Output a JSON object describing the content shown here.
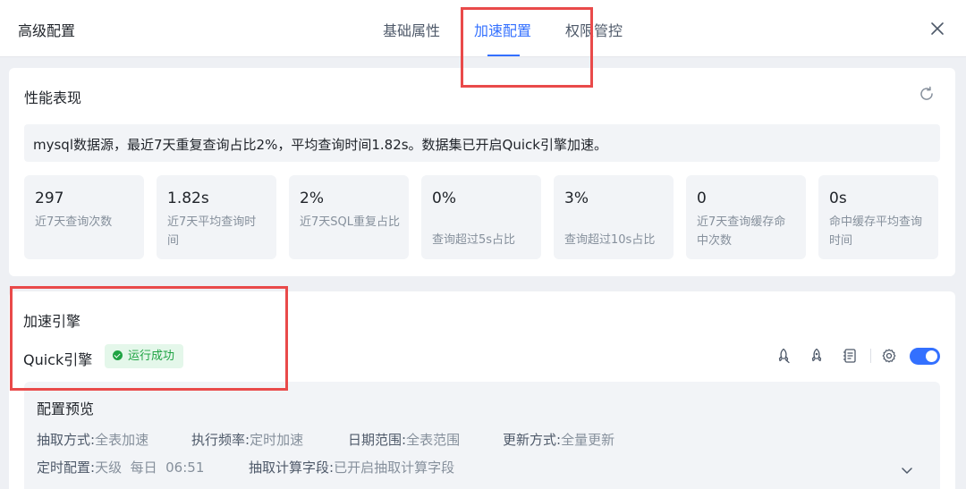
{
  "header": {
    "title": "高级配置",
    "tabs": [
      {
        "label": "基础属性",
        "active": false
      },
      {
        "label": "加速配置",
        "active": true
      },
      {
        "label": "权限管控",
        "active": false
      }
    ],
    "close_icon": "close-icon"
  },
  "performance": {
    "title": "性能表现",
    "refresh_icon": "refresh-icon",
    "summary": "mysql数据源，最近7天重复查询占比2%，平均查询时间1.82s。数据集已开启Quick引擎加速。",
    "metrics": [
      {
        "value": "297",
        "label": "近7天查询次数"
      },
      {
        "value": "1.82s",
        "label": "近7天平均查询时间"
      },
      {
        "value": "2%",
        "label": "近7天SQL重复占比"
      },
      {
        "value": "0%",
        "label": "查询超过5s占比"
      },
      {
        "value": "3%",
        "label": "查询超过10s占比"
      },
      {
        "value": "0",
        "label": "近7天查询缓存命中次数"
      },
      {
        "value": "0s",
        "label": "命中缓存平均查询时间"
      }
    ]
  },
  "engine": {
    "title": "加速引擎",
    "name": "Quick引擎",
    "status": "运行成功",
    "status_color": "#1fa343",
    "toolbar_icons": [
      "rocket-icon",
      "rocket-boost-icon",
      "log-icon",
      "gear-icon"
    ],
    "enabled": true,
    "preview": {
      "title": "配置预览",
      "row1": [
        {
          "key": "抽取方式:",
          "value": "全表加速"
        },
        {
          "key": "执行频率:",
          "value": "定时加速"
        },
        {
          "key": "日期范围:",
          "value": "全表范围"
        },
        {
          "key": "更新方式:",
          "value": "全量更新"
        }
      ],
      "row2": [
        {
          "key": "定时配置:",
          "value": "天级  每日  06:51"
        },
        {
          "key": "抽取计算字段:",
          "value": "已开启抽取计算字段"
        }
      ],
      "expand_icon": "chevron-down-icon"
    }
  },
  "colors": {
    "accent": "#3370ff",
    "highlight": "#e94a4a",
    "success_bg": "#e4f7ea"
  }
}
